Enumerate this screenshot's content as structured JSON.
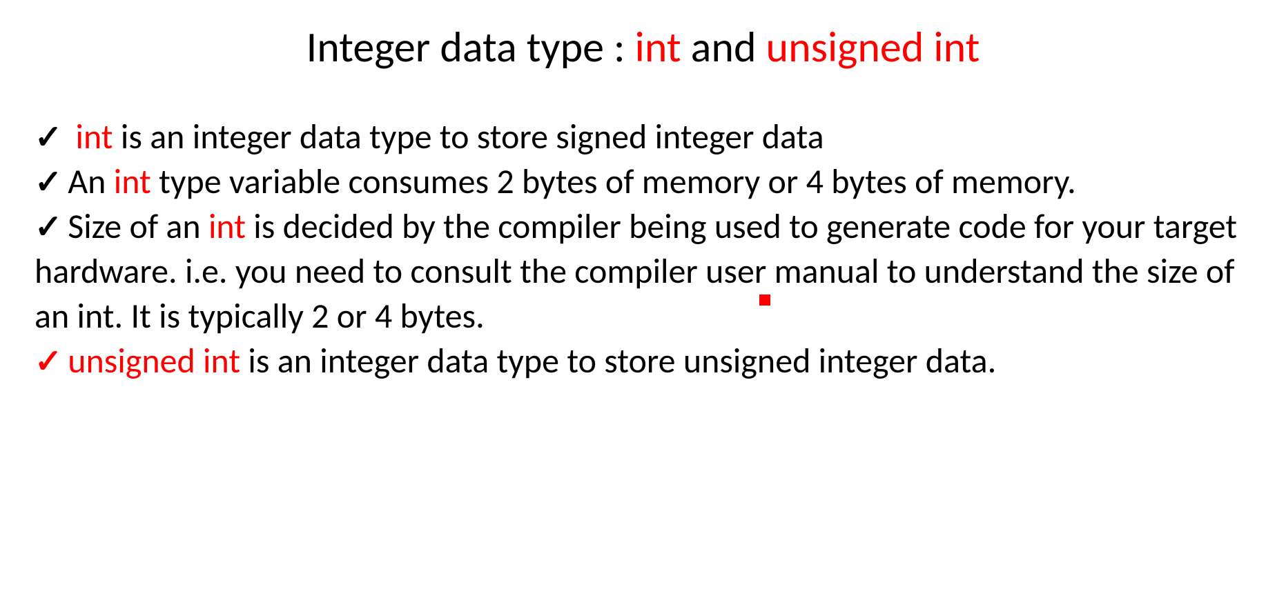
{
  "title": {
    "part1": "Integer data type : ",
    "part2": "int",
    "part3": " and ",
    "part4": "unsigned int"
  },
  "bullets": [
    {
      "checkmark_color": "black",
      "segments": [
        {
          "text": " int",
          "red": true
        },
        {
          "text": " is an integer data type to store signed integer data",
          "red": false
        }
      ]
    },
    {
      "checkmark_color": "black",
      "segments": [
        {
          "text": "An ",
          "red": false
        },
        {
          "text": "int",
          "red": true
        },
        {
          "text": " type variable consumes 2 bytes of memory or 4 bytes of memory.",
          "red": false
        }
      ]
    },
    {
      "checkmark_color": "black",
      "segments": [
        {
          "text": "Size of an ",
          "red": false
        },
        {
          "text": "int",
          "red": true
        },
        {
          "text": " is decided by the compiler being used to generate code for your target hardware. i.e. you need to consult the compiler user manual to understand the size of an int. It is typically 2 or 4 bytes.",
          "red": false
        }
      ]
    },
    {
      "checkmark_color": "red",
      "segments": [
        {
          "text": "unsigned int",
          "red": true
        },
        {
          "text": " is an integer data type to store unsigned integer data.",
          "red": false
        }
      ]
    }
  ]
}
